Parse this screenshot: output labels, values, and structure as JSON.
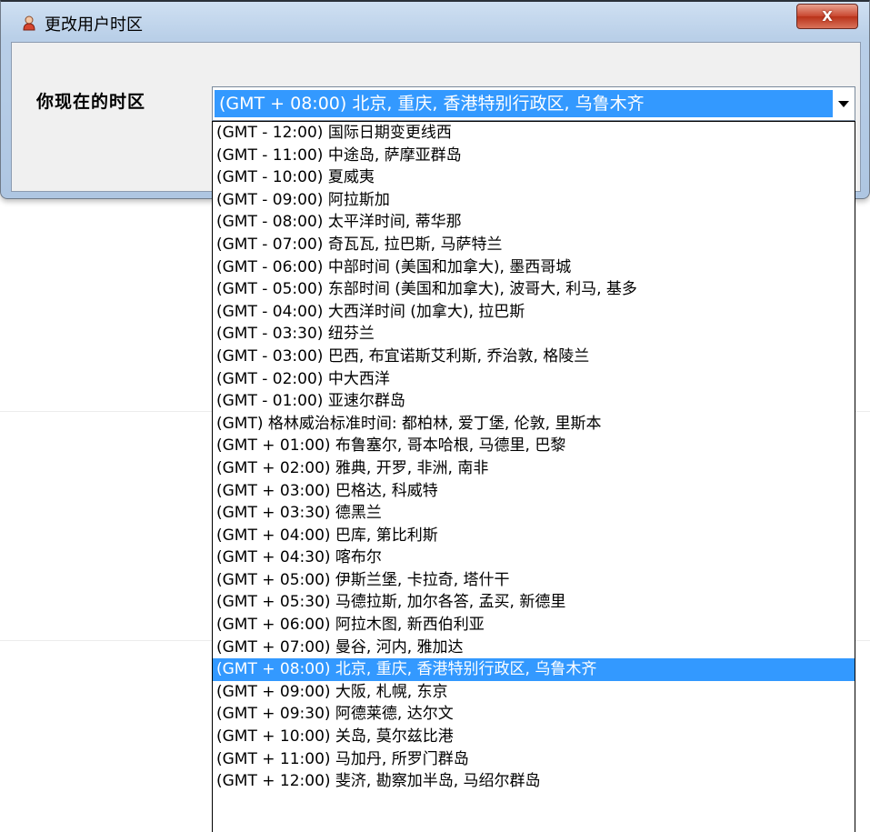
{
  "window": {
    "title": "更改用户时区",
    "close_label": "X"
  },
  "timezone": {
    "label": "你现在的时区",
    "selected": "(GMT + 08:00) 北京, 重庆, 香港特别行政区, 乌鲁木齐",
    "selected_index": 25,
    "options": [
      "(GMT - 12:00) 国际日期变更线西",
      "(GMT - 11:00) 中途岛, 萨摩亚群岛",
      "(GMT - 10:00) 夏威夷",
      "(GMT - 09:00) 阿拉斯加",
      "(GMT - 08:00) 太平洋时间, 蒂华那",
      "(GMT - 07:00) 奇瓦瓦, 拉巴斯, 马萨特兰",
      "(GMT - 06:00) 中部时间 (美国和加拿大), 墨西哥城",
      "(GMT - 05:00) 东部时间 (美国和加拿大), 波哥大, 利马, 基多",
      "(GMT - 04:00) 大西洋时间 (加拿大), 拉巴斯",
      "(GMT - 03:30) 纽芬兰",
      "(GMT - 03:00) 巴西, 布宜诺斯艾利斯, 乔治敦, 格陵兰",
      "(GMT - 02:00) 中大西洋",
      "(GMT - 01:00) 亚速尔群岛",
      "(GMT) 格林威治标准时间: 都柏林, 爱丁堡, 伦敦, 里斯本",
      "(GMT + 01:00) 布鲁塞尔, 哥本哈根, 马德里, 巴黎",
      "(GMT + 02:00) 雅典, 开罗, 非洲, 南非",
      "(GMT + 03:00) 巴格达, 科威特",
      "(GMT + 03:30) 德黑兰",
      "(GMT + 04:00) 巴库, 第比利斯",
      "(GMT + 04:30) 喀布尔",
      "(GMT + 05:00) 伊斯兰堡, 卡拉奇, 塔什干",
      "(GMT + 05:30) 马德拉斯, 加尔各答, 孟买, 新德里",
      "(GMT + 06:00) 阿拉木图, 新西伯利亚",
      "(GMT + 07:00) 曼谷, 河内, 雅加达",
      "(GMT + 08:00) 北京, 重庆, 香港特别行政区, 乌鲁木齐",
      "(GMT + 09:00) 大阪, 札幌, 东京",
      "(GMT + 09:30) 阿德莱德, 达尔文",
      "(GMT + 10:00) 关岛, 莫尔兹比港",
      "(GMT + 11:00) 马加丹, 所罗门群岛",
      "(GMT + 12:00) 斐济, 勘察加半岛, 马绍尔群岛"
    ]
  },
  "colors": {
    "selection": "#3399ff",
    "close_button": "#c9462f"
  }
}
